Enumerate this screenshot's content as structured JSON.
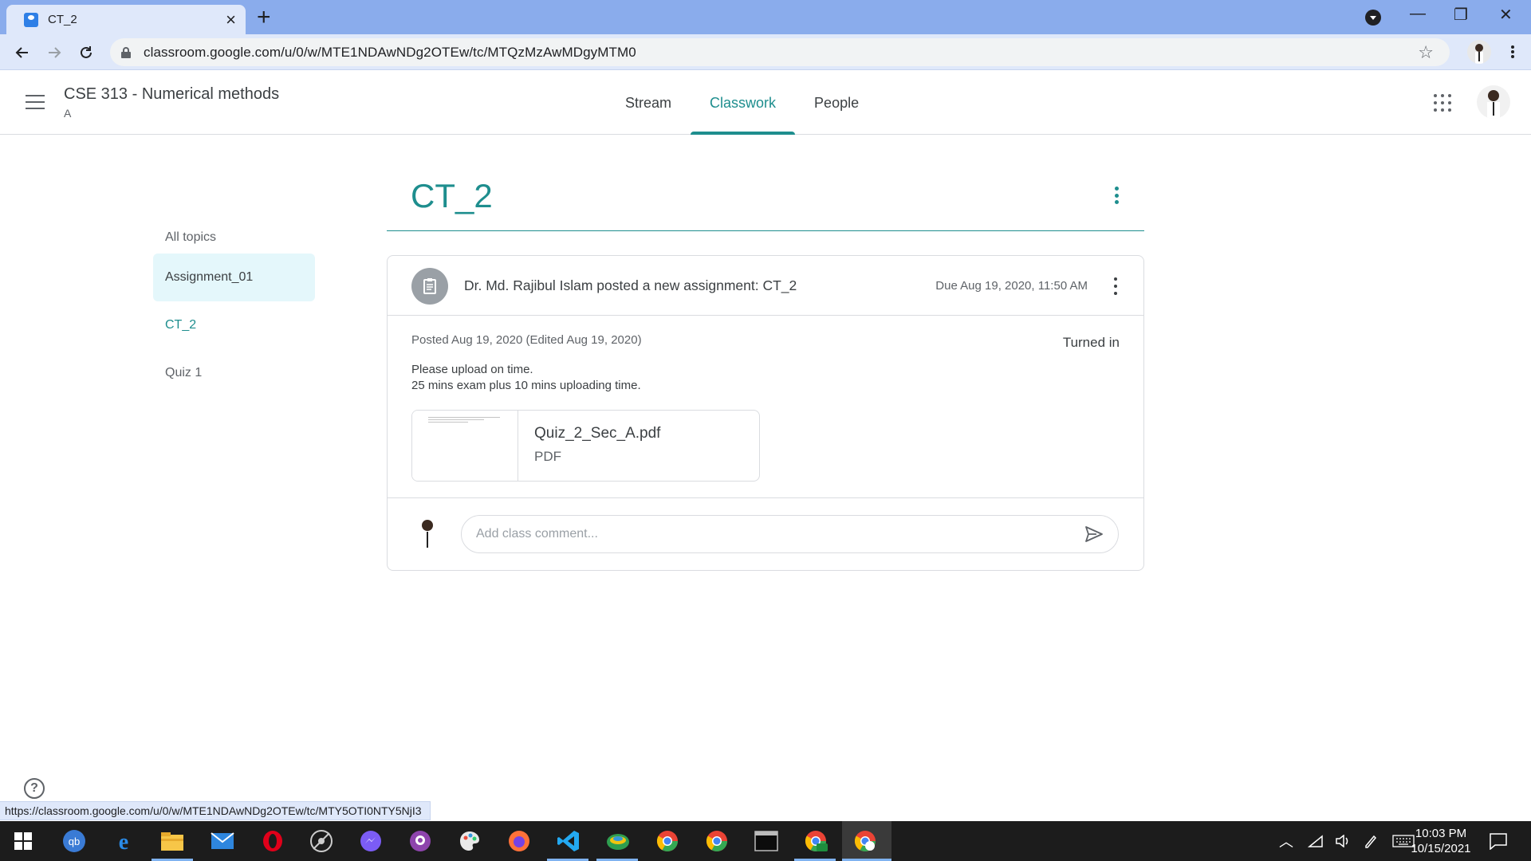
{
  "browser": {
    "tab_title": "CT_2",
    "url": "classroom.google.com/u/0/w/MTE1NDAwNDg2OTEw/tc/MTQzMzAwMDgyMTM0",
    "status_url": "https://classroom.google.com/u/0/w/MTE1NDAwNDg2OTEw/tc/MTY5OTI0NTY5NjI3"
  },
  "header": {
    "class_title": "CSE 313 - Numerical methods",
    "section": "A",
    "tabs": [
      {
        "label": "Stream"
      },
      {
        "label": "Classwork"
      },
      {
        "label": "People"
      }
    ],
    "active_tab": "Classwork",
    "accent_color": "#1e8e8e"
  },
  "sidebar": {
    "all_topics_label": "All topics",
    "items": [
      {
        "label": "Assignment_01"
      },
      {
        "label": "CT_2"
      },
      {
        "label": "Quiz 1"
      }
    ]
  },
  "topic": {
    "title": "CT_2"
  },
  "assignment": {
    "header": "Dr. Md. Rajibul Islam posted a new assignment: CT_2",
    "due": "Due Aug 19, 2020, 11:50 AM",
    "posted": "Posted Aug 19, 2020 (Edited Aug 19, 2020)",
    "status": "Turned in",
    "instructions": [
      "Please upload on time.",
      "25 mins exam plus 10 mins uploading time."
    ],
    "attachment": {
      "name": "Quiz_2_Sec_A.pdf",
      "type": "PDF"
    },
    "comment_placeholder": "Add class comment..."
  },
  "taskbar": {
    "time": "10:03 PM",
    "date": "10/15/2021",
    "apps": [
      "windows-start",
      "quickbooks",
      "edge",
      "file-explorer",
      "mail",
      "opera",
      "satellite-app",
      "messenger",
      "github-desktop",
      "paint-app",
      "firefox",
      "vscode",
      "earth-app",
      "chrome-profile",
      "chrome",
      "terminal",
      "chrome-ek",
      "chrome-active"
    ]
  }
}
